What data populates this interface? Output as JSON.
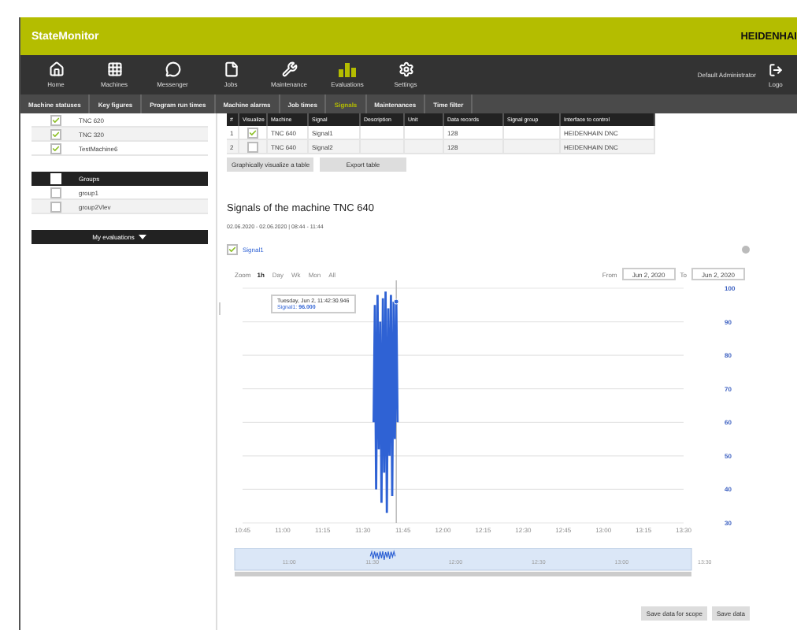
{
  "header": {
    "title": "StateMonitor",
    "brand": "HEIDENHAI"
  },
  "nav": {
    "items": [
      {
        "label": "Home",
        "selected": false
      },
      {
        "label": "Machines",
        "selected": false
      },
      {
        "label": "Messenger",
        "selected": false
      },
      {
        "label": "Jobs",
        "selected": false
      },
      {
        "label": "Maintenance",
        "selected": false
      },
      {
        "label": "Evaluations",
        "selected": true
      },
      {
        "label": "Settings",
        "selected": false
      }
    ],
    "user": "Default Administrator",
    "logout": "Logo"
  },
  "tabs": [
    {
      "label": "Machine statuses",
      "selected": false
    },
    {
      "label": "Key figures",
      "selected": false
    },
    {
      "label": "Program run times",
      "selected": false
    },
    {
      "label": "Machine alarms",
      "selected": false
    },
    {
      "label": "Job times",
      "selected": false
    },
    {
      "label": "Signals",
      "selected": true
    },
    {
      "label": "Maintenances",
      "selected": false
    },
    {
      "label": "Time filter",
      "selected": false
    }
  ],
  "machines": [
    {
      "name": "TNC 620",
      "checked": true
    },
    {
      "name": "TNC 320",
      "checked": true
    },
    {
      "name": "TestMachine6",
      "checked": true
    }
  ],
  "groups": {
    "all_checked": false,
    "title": "Groups",
    "rows": [
      {
        "name": "group1",
        "checked": false
      },
      {
        "name": "group2Vlev",
        "checked": false
      }
    ]
  },
  "my_evaluations": "My evaluations",
  "signals_table": {
    "columns": [
      "#",
      "Visualize",
      "Machine",
      "Signal",
      "Description",
      "Unit",
      "Data records",
      "Signal group",
      "Interface to control"
    ],
    "rows": [
      {
        "index": "1",
        "visualize": true,
        "machine": "TNC 640",
        "signal": "Signal1",
        "data_records": "128",
        "interface": "HEIDENHAIN DNC"
      },
      {
        "index": "2",
        "visualize": false,
        "machine": "TNC 640",
        "signal": "Signal2",
        "data_records": "128",
        "interface": "HEIDENHAIN DNC"
      }
    ]
  },
  "table_buttons": [
    "Graphically visualize a table",
    "Export table"
  ],
  "chart_section": {
    "title": "Signals of the machine TNC 640",
    "period": "02.06.2020 - 02.06.2020 | 08:44 - 11:44",
    "legend": {
      "checked": true
    },
    "zoom": {
      "label": "Zoom",
      "options": [
        {
          "label": "1h",
          "selected": true
        },
        {
          "label": "Day",
          "selected": false
        },
        {
          "label": "Wk",
          "selected": false
        },
        {
          "label": "Mon",
          "selected": false
        },
        {
          "label": "All",
          "selected": false
        }
      ]
    },
    "from": {
      "label": "From",
      "value": "Jun 2, 2020"
    },
    "to": {
      "label": "To",
      "value": "Jun 2, 2020"
    },
    "tooltip": {
      "date": "Tuesday, Jun 2, 11:42:30.946",
      "value": "Signal1: **96.000**"
    },
    "chart_data": {
      "type": "line",
      "grid": true,
      "ref_lines": [
        {
          "axis": "x",
          "value": 702.5
        }
      ],
      "xlim": [
        645,
        810
      ],
      "ylim": [
        30,
        100
      ],
      "xticks": [
        {
          "value": 645,
          "label": "10:45"
        },
        {
          "value": 660,
          "label": "11:00"
        },
        {
          "value": 675,
          "label": "11:15"
        },
        {
          "value": 690,
          "label": "11:30"
        },
        {
          "value": 705,
          "label": "11:45"
        },
        {
          "value": 720,
          "label": "12:00"
        },
        {
          "value": 735,
          "label": "12:15"
        },
        {
          "value": 750,
          "label": "12:30"
        },
        {
          "value": 765,
          "label": "12:45"
        },
        {
          "value": 780,
          "label": "13:00"
        },
        {
          "value": 795,
          "label": "13:15"
        },
        {
          "value": 810,
          "label": "13:30"
        }
      ],
      "yticks": [
        30,
        40,
        50,
        60,
        70,
        80,
        90,
        100
      ],
      "x": [
        694,
        694.5,
        695,
        695.5,
        696,
        696.5,
        697,
        697.5,
        698,
        698.5,
        699,
        699.5,
        700,
        700.5,
        701,
        701.5,
        702,
        702.5,
        703
      ],
      "series": [
        {
          "name": "Signal1",
          "color": "#2f62d4",
          "values": [
            60,
            95,
            40,
            98,
            52,
            90,
            36,
            97,
            45,
            99,
            33,
            94,
            50,
            98,
            38,
            96,
            55,
            96,
            60
          ]
        }
      ]
    },
    "navigator_labels": [
      "11:00",
      "11:30",
      "12:00",
      "12:30",
      "13:00",
      "13:30"
    ]
  },
  "save_buttons": [
    "Save data for scope",
    "Save data"
  ]
}
